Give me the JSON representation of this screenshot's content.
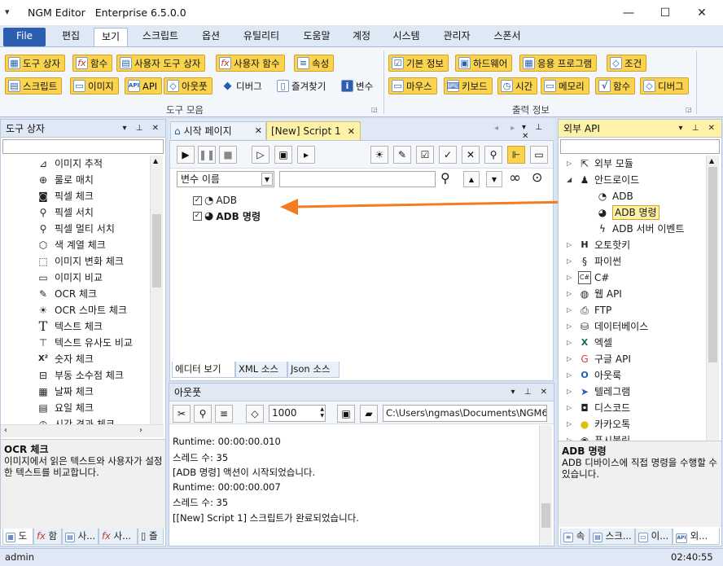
{
  "window": {
    "app_name": "NGM Editor",
    "edition": "Enterprise 6.5.0.0"
  },
  "menu": [
    "File",
    "편집",
    "보기",
    "스크립트",
    "옵션",
    "유틸리티",
    "도움말",
    "계정",
    "시스템",
    "관리자",
    "스폰서"
  ],
  "ribbon": {
    "tool_group_label": "도구 모음",
    "output_group_label": "출력 정보",
    "tool_row1": [
      "도구 상자",
      "함수",
      "사용자 도구 상자",
      "사용자 함수",
      "속성"
    ],
    "tool_row2": [
      "스크립트",
      "이미지",
      "API",
      "아웃풋",
      "디버그",
      "즐겨찾기",
      "변수"
    ],
    "output_row1": [
      "기본 정보",
      "하드웨어",
      "응용 프로그램",
      "조건"
    ],
    "output_row2": [
      "마우스",
      "키보드",
      "시간",
      "메모리",
      "함수",
      "디버그"
    ]
  },
  "toolbox": {
    "title": "도구 상자",
    "items": [
      {
        "label": "이미지 추적",
        "icon": "image-track-icon"
      },
      {
        "label": "룰로 매치",
        "icon": "match-icon"
      },
      {
        "label": "픽셀 체크",
        "icon": "camera-icon"
      },
      {
        "label": "픽셀 서치",
        "icon": "magnifier-icon"
      },
      {
        "label": "픽셀 멀티 서치",
        "icon": "magnifier-icon"
      },
      {
        "label": "색 계열 체크",
        "icon": "cube-icon"
      },
      {
        "label": "이미지 변화 체크",
        "icon": "dashed-box-icon"
      },
      {
        "label": "이미지 비교",
        "icon": "image-compare-icon"
      },
      {
        "label": "OCR 체크",
        "icon": "ocr-icon"
      },
      {
        "label": "OCR 스마트 체크",
        "icon": "bulb-icon"
      },
      {
        "label": "텍스트 체크",
        "icon": "text-t-icon"
      },
      {
        "label": "텍스트 유사도 비교",
        "icon": "text-compare-icon"
      },
      {
        "label": "숫자 체크",
        "icon": "number-icon"
      },
      {
        "label": "부동 소수점 체크",
        "icon": "float-icon"
      },
      {
        "label": "날짜 체크",
        "icon": "calendar-icon"
      },
      {
        "label": "요일 체크",
        "icon": "calendar-week-icon"
      },
      {
        "label": "시간 경과 체크",
        "icon": "clock-icon"
      }
    ],
    "desc_title": "OCR 체크",
    "desc_body": "이미지에서 읽은 텍스트와 사용자가 설정한 텍스트를 비교합니다.",
    "bottom_tabs": [
      "도",
      "함",
      "사...",
      "사...",
      "즐"
    ]
  },
  "editor": {
    "tabs": [
      "시작 페이지",
      "[New] Script 1"
    ],
    "var_select": "변수 이름",
    "lines": [
      {
        "label": "ADB",
        "bold": false
      },
      {
        "label": "ADB 명령",
        "bold": true
      }
    ],
    "bottom_tabs": [
      "에디터 보기",
      "XML 소스",
      "Json 소스"
    ]
  },
  "output": {
    "title": "아웃풋",
    "line_count": "1000",
    "path": "C:\\Users\\ngmas\\Documents\\NGM6\\",
    "lines": [
      "Runtime: 00:00:00.010",
      "스레드 수: 35",
      "[ADB 명령] 액션이 시작되었습니다.",
      "Runtime: 00:00:00.007",
      "스레드 수: 35",
      "[[New] Script 1] 스크립트가 완료되었습니다."
    ]
  },
  "api": {
    "title": "외부 API",
    "items": [
      {
        "label": "외부 모듈",
        "indent": 0,
        "arrow": "▷",
        "icon": "external-module-icon"
      },
      {
        "label": "안드로이드",
        "indent": 0,
        "arrow": "◢",
        "icon": "android-icon"
      },
      {
        "label": "ADB",
        "indent": 1,
        "arrow": "",
        "icon": "adb-icon"
      },
      {
        "label": "ADB 명령",
        "indent": 1,
        "arrow": "",
        "icon": "adb-command-icon",
        "selected": true
      },
      {
        "label": "ADB 서버 이벤트",
        "indent": 1,
        "arrow": "",
        "icon": "lightning-icon"
      },
      {
        "label": "오토핫키",
        "indent": 0,
        "arrow": "▷",
        "icon": "autohotkey-icon"
      },
      {
        "label": "파이썬",
        "indent": 0,
        "arrow": "▷",
        "icon": "python-icon"
      },
      {
        "label": "C#",
        "indent": 0,
        "arrow": "▷",
        "icon": "csharp-icon"
      },
      {
        "label": "웹 API",
        "indent": 0,
        "arrow": "▷",
        "icon": "globe-icon"
      },
      {
        "label": "FTP",
        "indent": 0,
        "arrow": "▷",
        "icon": "ftp-icon"
      },
      {
        "label": "데이터베이스",
        "indent": 0,
        "arrow": "▷",
        "icon": "database-icon"
      },
      {
        "label": "엑셀",
        "indent": 0,
        "arrow": "▷",
        "icon": "excel-icon"
      },
      {
        "label": "구글 API",
        "indent": 0,
        "arrow": "▷",
        "icon": "google-icon"
      },
      {
        "label": "아웃룩",
        "indent": 0,
        "arrow": "▷",
        "icon": "outlook-icon"
      },
      {
        "label": "텔레그램",
        "indent": 0,
        "arrow": "▷",
        "icon": "telegram-icon"
      },
      {
        "label": "디스코드",
        "indent": 0,
        "arrow": "▷",
        "icon": "discord-icon"
      },
      {
        "label": "카카오톡",
        "indent": 0,
        "arrow": "▷",
        "icon": "kakaotalk-icon"
      },
      {
        "label": "푸시불릿",
        "indent": 0,
        "arrow": "▷",
        "icon": "pushbullet-icon"
      }
    ],
    "desc_title": "ADB 명령",
    "desc_body": "ADB 디바이스에 직접 명령을 수행할 수 있습니다.",
    "bottom_tabs": [
      "속",
      "스크...",
      "이...",
      "외..."
    ]
  },
  "status": {
    "user": "admin",
    "time": "02:40:55"
  },
  "colors": {
    "accent": "#2b5eb1",
    "ribbon_button": "#fbd44f",
    "arrow": "#f47b20",
    "panel_highlight": "#fdf2a8"
  }
}
